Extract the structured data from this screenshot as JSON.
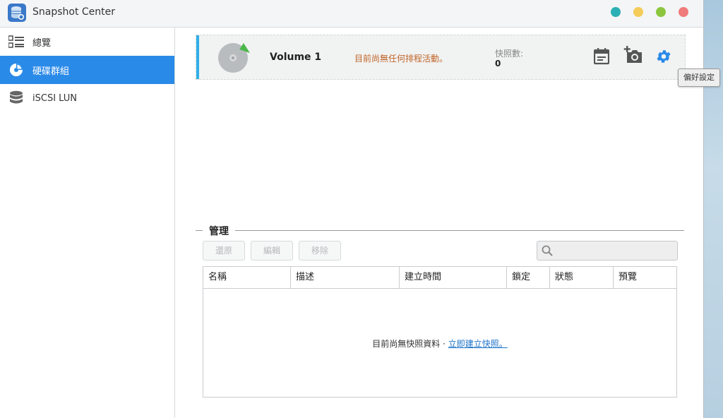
{
  "app": {
    "title": "Snapshot Center",
    "window_buttons": [
      {
        "name": "window-button-teal",
        "color": "#2bb0b5"
      },
      {
        "name": "window-button-yellow",
        "color": "#f5cc5a"
      },
      {
        "name": "window-button-green",
        "color": "#8cc63f"
      },
      {
        "name": "window-button-red",
        "color": "#f07b7b"
      }
    ]
  },
  "sidebar": {
    "items": [
      {
        "label": "總覽",
        "icon": "overview-list-icon",
        "active": false
      },
      {
        "label": "硬碟群組",
        "icon": "disk-group-icon",
        "active": true
      },
      {
        "label": "iSCSI LUN",
        "icon": "database-icon",
        "active": false
      }
    ]
  },
  "volume": {
    "name": "Volume 1",
    "status": "目前尚無任何排程活動。",
    "snapshot_label": "快照數:",
    "snapshot_count": "0",
    "tooltip": "偏好設定"
  },
  "manage": {
    "title": "管理",
    "buttons": {
      "restore": "還原",
      "edit": "編輯",
      "remove": "移除"
    },
    "search_placeholder": "",
    "columns": [
      "名稱",
      "描述",
      "建立時間",
      "鎖定",
      "狀態",
      "預覽"
    ],
    "empty_text": "目前尚無快照資料 · ",
    "empty_link": "立即建立快照。"
  },
  "colors": {
    "accent": "#2a8ae8",
    "volume_accent": "#31b0e8",
    "status_orange": "#c0662a",
    "gear_blue": "#2a8ae8"
  }
}
